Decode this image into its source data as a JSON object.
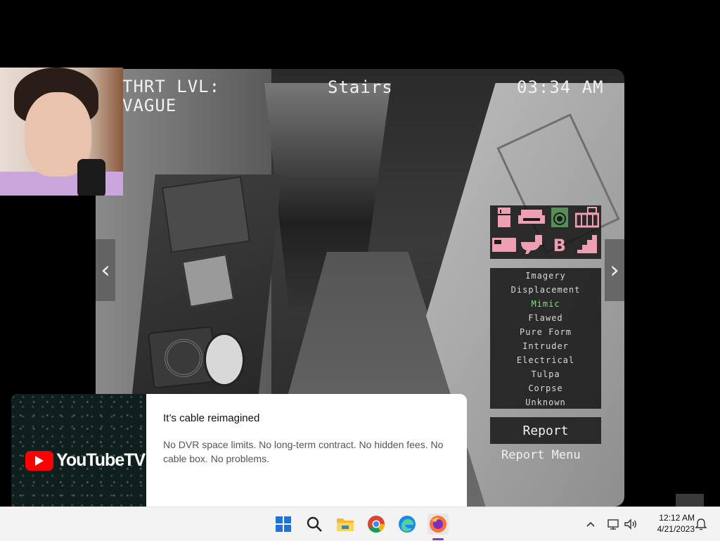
{
  "game": {
    "threat_label": "THRT LVL:",
    "threat_value": "VAGUE",
    "room": "Stairs",
    "time": "03:34 AM",
    "nav_left": "‹",
    "nav_right": "›",
    "room_icons": [
      "fridge-icon",
      "couch-icon",
      "washer-icon",
      "crib-icon",
      "bed-icon",
      "toilet-icon",
      "basement-icon",
      "stairs-icon"
    ],
    "basement_glyph": "B",
    "anomalies": [
      "Imagery",
      "Displacement",
      "Mimic",
      "Flawed",
      "Pure Form",
      "Intruder",
      "Electrical",
      "Tulpa",
      "Corpse",
      "Unknown"
    ],
    "selected_anomaly": "Mimic",
    "report_button": "Report",
    "report_menu": "Report Menu",
    "icon_color": "#ee9fb1",
    "selected_color": "#7be07b"
  },
  "ad": {
    "brand": "YouTubeTV",
    "title": "It’s cable reimagined",
    "description": "No DVR space limits. No long-term contract. No hidden fees. No cable box. No problems."
  },
  "taskbar": {
    "apps": [
      "windows-start-icon",
      "search-icon",
      "file-explorer-icon",
      "chrome-icon",
      "edge-icon",
      "firefox-icon"
    ],
    "time": "12:12 AM",
    "date": "4/21/2023"
  }
}
